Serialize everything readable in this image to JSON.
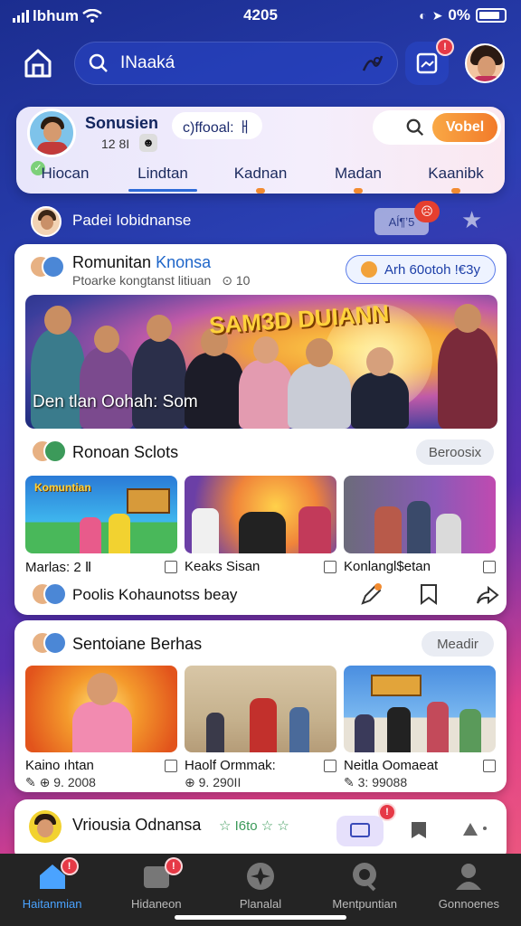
{
  "status_bar": {
    "carrier": "lbhum",
    "time": "4205",
    "battery": "0%"
  },
  "search": {
    "placeholder": "INaaká"
  },
  "profile": {
    "name": "Sonusien",
    "meta": "12 8I",
    "status": "c)ffooal: ㅐ",
    "search_button": "Vobel"
  },
  "profile_tabs": [
    "Hiocan",
    "Lindtan",
    "Kadnan",
    "Madan",
    "Kaanibk"
  ],
  "community_row": {
    "label": "Padei Iobidnanse",
    "pill": "Aĺ¶ʼ5"
  },
  "card1": {
    "title": "Romunitan",
    "title_accent": "Knonsa",
    "subtitle": "Ptoarke kongtanst litiuan",
    "meta": "⊙ 10",
    "chip": "Arh 60otoh !€3y",
    "hero_title": "SAM3D DUIANN",
    "hero_caption": "Den tlan Oohah: Som",
    "section_title": "Ronoan Sclots",
    "section_chip": "Beroosix",
    "thumbs": [
      {
        "title": "Marlas: 2 Ⅱ",
        "banner": "Komuntian"
      },
      {
        "title": "Keaks Sisan"
      },
      {
        "title": "Konlangl$etan"
      }
    ],
    "action_label": "Poolis Kohaunotss beay"
  },
  "card2": {
    "title": "Sentoiane Berhas",
    "chip": "Meadir",
    "thumbs": [
      {
        "title": "Kaino ıhtan",
        "meta": "9. 2008"
      },
      {
        "title": "Haolf Ormmak:",
        "meta": "9. 290II"
      },
      {
        "title": "Neitla Oomaeat",
        "meta": "3: 99088"
      }
    ]
  },
  "card3": {
    "title": "Vriousia Odnansa",
    "meta": "☆ I6to ☆ ☆"
  },
  "bottom_nav": [
    {
      "label": "Haitanmian",
      "badge": ""
    },
    {
      "label": "Hidaneon",
      "badge": ""
    },
    {
      "label": "Planalal",
      "badge": ""
    },
    {
      "label": "Mentpuntian",
      "badge": ""
    },
    {
      "label": "Gonnoenes",
      "badge": ""
    }
  ],
  "colors": {
    "accent": "#2f6bd8",
    "orange": "#f27b2a",
    "badge": "#e63946",
    "nav_active": "#4aa3ff"
  }
}
